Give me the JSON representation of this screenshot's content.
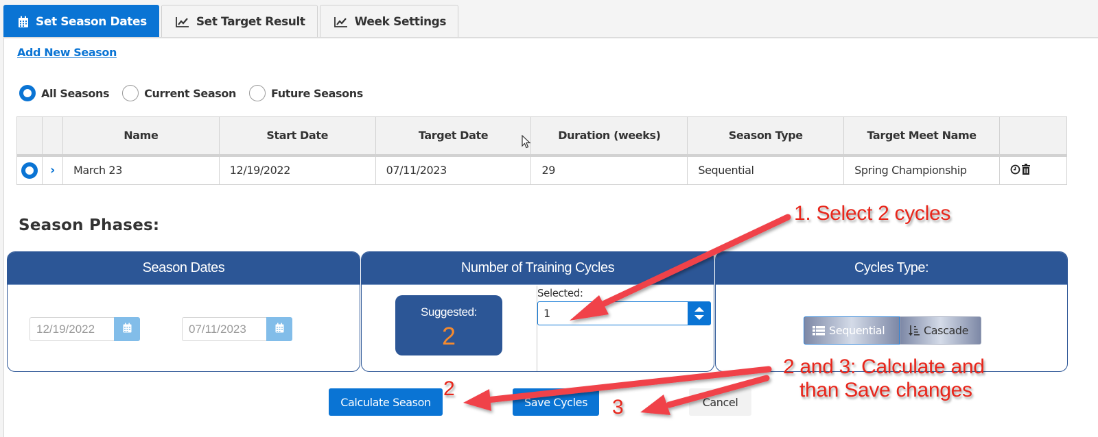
{
  "tabs": [
    {
      "label": "Set Season Dates",
      "icon": "calendar-icon",
      "active": true
    },
    {
      "label": "Set Target Result",
      "icon": "line-chart-icon",
      "active": false
    },
    {
      "label": "Week Settings",
      "icon": "line-chart-icon",
      "active": false
    }
  ],
  "add_season_link": "Add New Season",
  "filter": {
    "options": [
      {
        "label": "All Seasons",
        "selected": true
      },
      {
        "label": "Current Season",
        "selected": false
      },
      {
        "label": "Future Seasons",
        "selected": false
      }
    ]
  },
  "table": {
    "columns": [
      "",
      "",
      "Name",
      "Start Date",
      "Target Date",
      "Duration (weeks)",
      "Season Type",
      "Target Meet Name",
      ""
    ],
    "rows": [
      {
        "selected": true,
        "name": "March 23",
        "start_date": "12/19/2022",
        "target_date": "07/11/2023",
        "duration_weeks": "29",
        "season_type": "Sequential",
        "target_meet_name": "Spring Championship",
        "actions": [
          "clock-icon",
          "trash-icon"
        ]
      }
    ]
  },
  "season_phases": {
    "title": "Season Phases:",
    "season_dates": {
      "header": "Season Dates",
      "start_date": "12/19/2022",
      "end_date": "07/11/2023"
    },
    "training_cycles": {
      "header": "Number of Training Cycles",
      "suggested_label": "Suggested:",
      "suggested_value": "2",
      "selected_label": "Selected:",
      "selected_value": "1"
    },
    "cycles_type": {
      "header": "Cycles Type:",
      "options": [
        {
          "label": "Sequential",
          "icon": "list-icon",
          "selected": true
        },
        {
          "label": "Cascade",
          "icon": "sort-icon",
          "selected": false
        }
      ]
    }
  },
  "buttons": {
    "calculate": "Calculate Season",
    "save": "Save Cycles",
    "cancel": "Cancel"
  },
  "annotations": {
    "step1": "1. Select 2 cycles",
    "step23_line1": "2 and 3: Calculate and",
    "step23_line2": "than Save changes",
    "num2": "2",
    "num3": "3",
    "color": "#e8261b"
  },
  "colors": {
    "accent": "#0a74d4",
    "card_header": "#2c5696",
    "suggested_value": "#f58a2e"
  }
}
